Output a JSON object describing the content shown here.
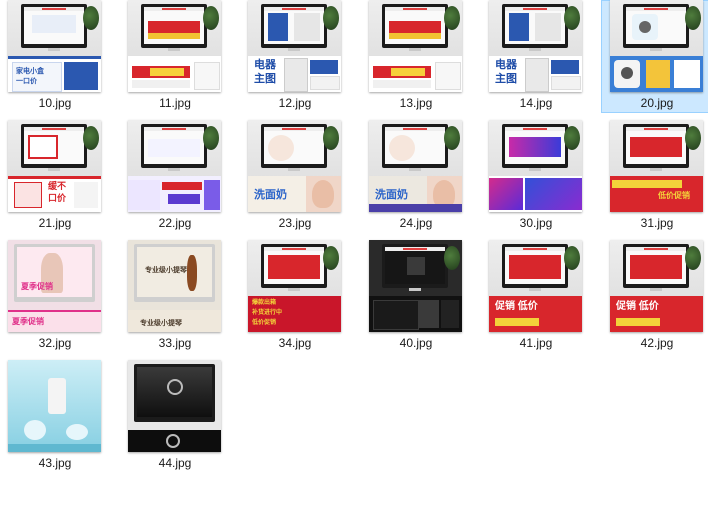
{
  "files": [
    {
      "name": "10.jpg",
      "style": "white-blue",
      "selected": false
    },
    {
      "name": "11.jpg",
      "style": "red-gold",
      "selected": false
    },
    {
      "name": "12.jpg",
      "style": "blue-appliance",
      "selected": false
    },
    {
      "name": "13.jpg",
      "style": "red-gold",
      "selected": false
    },
    {
      "name": "14.jpg",
      "style": "blue-appliance",
      "selected": false
    },
    {
      "name": "20.jpg",
      "style": "camera-blue",
      "selected": true
    },
    {
      "name": "21.jpg",
      "style": "white-red",
      "selected": false
    },
    {
      "name": "22.jpg",
      "style": "purple-promo",
      "selected": false
    },
    {
      "name": "23.jpg",
      "style": "beauty",
      "selected": false
    },
    {
      "name": "24.jpg",
      "style": "beauty-dark",
      "selected": false
    },
    {
      "name": "30.jpg",
      "style": "magenta-blue",
      "selected": false
    },
    {
      "name": "31.jpg",
      "style": "red-yellow",
      "selected": false
    },
    {
      "name": "32.jpg",
      "style": "pink-summer",
      "selected": false
    },
    {
      "name": "33.jpg",
      "style": "violin",
      "selected": false
    },
    {
      "name": "34.jpg",
      "style": "red-panel",
      "selected": false
    },
    {
      "name": "40.jpg",
      "style": "black",
      "selected": false
    },
    {
      "name": "41.jpg",
      "style": "red-sale",
      "selected": false
    },
    {
      "name": "42.jpg",
      "style": "red-sale",
      "selected": false
    },
    {
      "name": "43.jpg",
      "style": "aqua",
      "selected": false
    },
    {
      "name": "44.jpg",
      "style": "watch-dark",
      "selected": false
    }
  ],
  "banner_text": {
    "10": [
      "家电小盒",
      "一口价"
    ],
    "12": [
      "电器",
      "主图"
    ],
    "14": [
      "电器",
      "主图"
    ],
    "21": [
      "缓不",
      "口价"
    ],
    "23": "洗面奶",
    "24": "洗面奶",
    "31": "低价促销",
    "32": "夏季促销",
    "33": "专业级小提琴",
    "34": [
      "爆款出箱",
      "补货进行中",
      "低价促销"
    ],
    "41": "促销 低价",
    "42": "促销 低价"
  },
  "colors": {
    "selection_bg": "#cce8ff",
    "selection_border": "#99d1ff",
    "label": "#1a1a1a"
  }
}
